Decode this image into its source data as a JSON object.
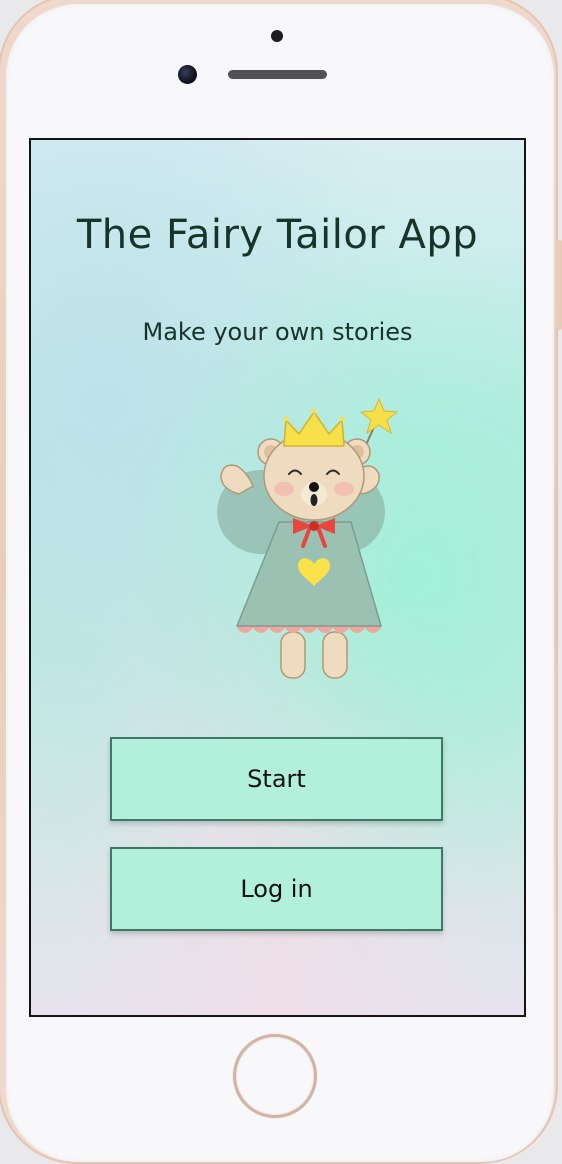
{
  "app": {
    "title": "The Fairy Tailor App",
    "subtitle": "Make your own stories"
  },
  "buttons": {
    "start_label": "Start",
    "login_label": "Log in"
  },
  "illustration": {
    "name": "fairy-bear-icon"
  },
  "colors": {
    "button_fill": "#b2f0dc",
    "button_border": "#3d7a66",
    "title_text": "#17332a",
    "screen_gradient_mint": "#a0f0d7",
    "phone_frame": "#e8cdbd"
  }
}
